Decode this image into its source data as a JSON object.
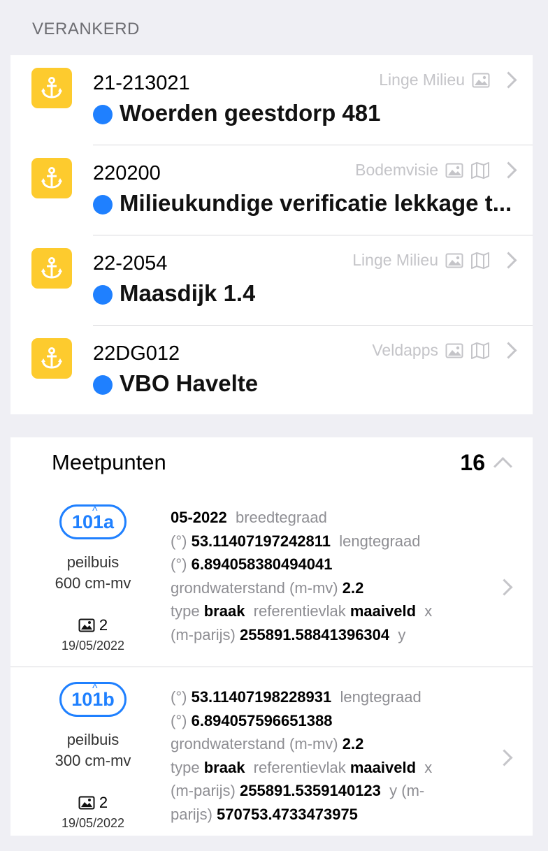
{
  "section_title": "VERANKERD",
  "anchored": [
    {
      "code": "21-213021",
      "name": "Woerden geestdorp 481",
      "org": "Linge Milieu",
      "icons": [
        "image-icon"
      ]
    },
    {
      "code": "220200",
      "name": "Milieukundige verificatie lekkage t...",
      "org": "Bodemvisie",
      "icons": [
        "image-icon",
        "map-icon"
      ]
    },
    {
      "code": "22-2054",
      "name": "Maasdijk 1.4",
      "org": "Linge Milieu",
      "icons": [
        "image-icon",
        "map-icon"
      ]
    },
    {
      "code": "22DG012",
      "name": "VBO Havelte",
      "org": "Veldapps",
      "icons": [
        "image-icon",
        "map-icon"
      ]
    }
  ],
  "meetpunten": {
    "title": "Meetpunten",
    "count": "16",
    "items": [
      {
        "id": "101a",
        "type": "peilbuis",
        "depth": "600 cm-mv",
        "photos": "2",
        "date": "19/05/2022",
        "date_main": "05-2022",
        "l_breed": "breedtegraad",
        "unit_deg1": "(°)",
        "breed": "53.11407197242811",
        "l_lengte": "lengtegraad",
        "unit_deg2": "(°)",
        "lengte": "6.894058380494041",
        "l_grondwater": "grondwaterstand (m-mv)",
        "grondwater": "2.2",
        "l_type": "type",
        "type_val": "braak",
        "l_ref": "referentievlak",
        "ref": "maaiveld",
        "l_x": "x",
        "l_x_unit": "(m-parijs)",
        "x": "255891.58841396304",
        "l_y": "y"
      },
      {
        "id": "101b",
        "type": "peilbuis",
        "depth": "300 cm-mv",
        "photos": "2",
        "date": "19/05/2022",
        "unit_deg1": "(°)",
        "breed": "53.11407198228931",
        "l_lengte": "lengtegraad",
        "unit_deg2": "(°)",
        "lengte": "6.894057596651388",
        "l_grondwater": "grondwaterstand (m-mv)",
        "grondwater": "2.2",
        "l_type": "type",
        "type_val": "braak",
        "l_ref": "referentievlak",
        "ref": "maaiveld",
        "l_x": "x",
        "l_x_unit": "(m-parijs)",
        "x": "255891.5359140123",
        "l_y": "y (m-",
        "l_y_unit": "parijs)",
        "y": "570753.4733473975"
      }
    ]
  },
  "colors": {
    "accent": "#1f80ff",
    "anchor_bg": "#fdcb2e"
  }
}
